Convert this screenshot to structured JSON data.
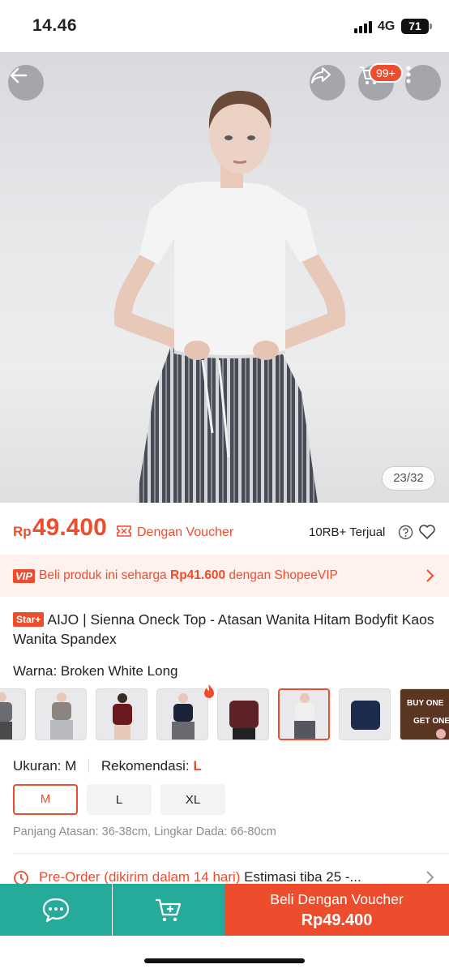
{
  "status_bar": {
    "time": "14.46",
    "network": "4G",
    "battery": "71"
  },
  "header": {
    "cart_badge": "99+",
    "image_counter": "23/32"
  },
  "price": {
    "currency": "Rp",
    "amount": "49.400",
    "voucher_label": "Dengan Voucher",
    "sold": "10RB+ Terjual"
  },
  "vip": {
    "badge": "VIP",
    "text_prefix": "Beli produk ini seharga ",
    "vip_price": "Rp41.600",
    "text_suffix": " dengan ShopeeVIP"
  },
  "product": {
    "badge": "Star+",
    "title": "AIJO | Sienna Oneck Top - Atasan Wanita Hitam Bodyfit Kaos Wanita Spandex"
  },
  "variant": {
    "label": "Warna:",
    "selected": "Broken White Long",
    "promo_lines": [
      "BUY ONE",
      "GET ONE"
    ]
  },
  "size": {
    "label": "Ukuran:",
    "selected": "M",
    "recommend_label": "Rekomendasi:",
    "recommend_value": "L",
    "options": [
      "M",
      "L",
      "XL"
    ],
    "note": "Panjang Atasan: 36-38cm, Lingkar Dada: 66-80cm"
  },
  "preorder": {
    "label": "Pre-Order (dikirim dalam 14 hari)",
    "estimate": " Estimasi tiba 25 -..."
  },
  "bottom_bar": {
    "buy_label": "Beli Dengan Voucher",
    "buy_price": "Rp49.400"
  },
  "colors": {
    "accent": "#ee4d2d",
    "teal": "#26aa99"
  }
}
